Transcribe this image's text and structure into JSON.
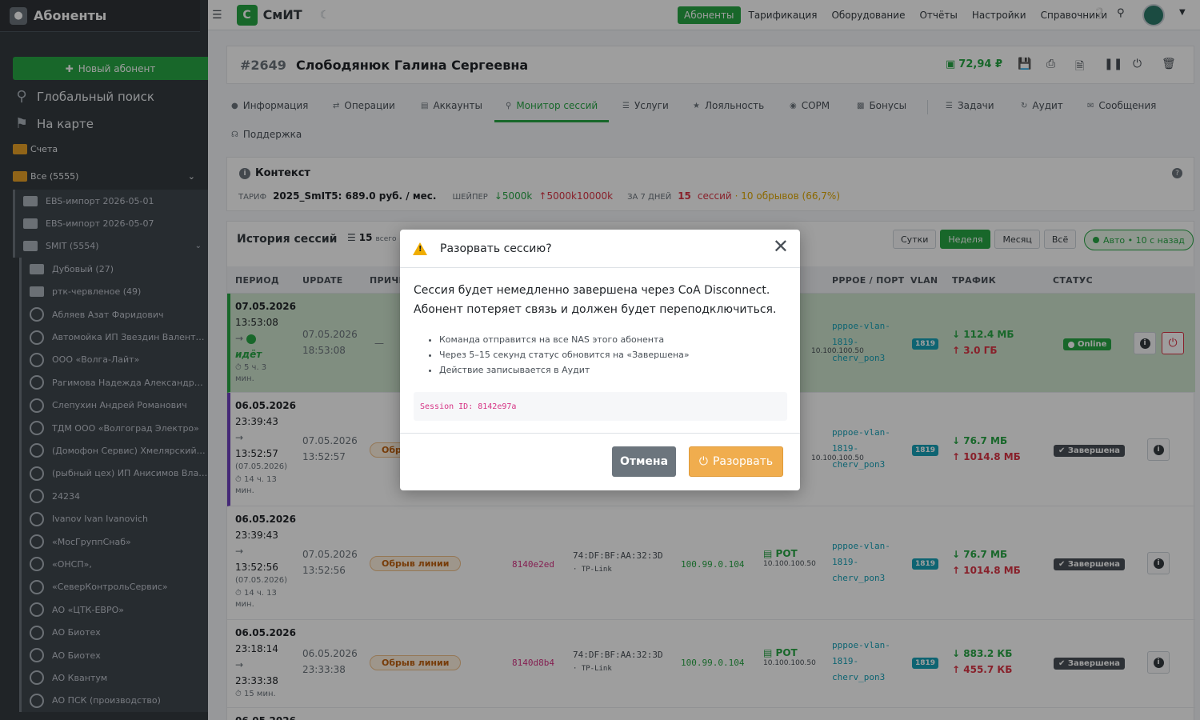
{
  "sidebar": {
    "brand": "Абоненты",
    "new_button": "Новый абонент",
    "global_search": "Глобальный поиск",
    "on_map": "На карте",
    "accounts": "Счета",
    "all": "Все (5555)",
    "folders": [
      "EBS-импорт 2026-05-01",
      "EBS-импорт 2026-05-07",
      "SMIT (5554)"
    ],
    "subfolders": [
      "Дубовый (27)",
      "ртк-червленое (49)"
    ],
    "items": [
      "Абляев Азат Фаридович",
      "Автомойка ИП Звездин Валентин ...",
      "ООО «Волга-Лайт»",
      "Рагимова Надежда Александровна",
      "Слепухин Андрей Романович",
      "ТДМ ООО «Волгоград Электро»",
      "(Домофон Сервис) Хмелярский Се...",
      "(рыбный цех) ИП Анисимов Влади...",
      "24234",
      "Ivanov Ivan Ivanovich",
      "«МосГруппСнаб»",
      "«ОНСП»,",
      "«СеверКонтрольСервис»",
      "АО «ЦТК-ЕВРО»",
      "АО Биотех",
      "АО Биотех",
      "АО Квантум",
      "АО ПСК (производство)"
    ]
  },
  "topnav": {
    "logo_letter": "С",
    "logo_text": "СмИТ",
    "menu": [
      "Абоненты",
      "Тарификация",
      "Оборудование",
      "Отчёты",
      "Настройки",
      "Справочники"
    ]
  },
  "subscriber": {
    "id": "#2649",
    "name": "Слободянюк Галина Сергеевна",
    "balance": "72,94 ₽"
  },
  "tabs": [
    "Информация",
    "Операции",
    "Аккаунты",
    "Монитор сессий",
    "Услуги",
    "Лояльность",
    "СОРМ",
    "Бонусы",
    "Задачи",
    "Аудит",
    "Сообщения",
    "Поддержка"
  ],
  "context": {
    "title": "Контекст",
    "tariff_label": "ТАРИФ",
    "tariff": "2025_SmIT5: 689.0 руб. / мес.",
    "shaper_label": "ШЕЙПЕР",
    "shaper_down": "5000k",
    "shaper_up": "5000k10000k",
    "days_label": "ЗА 7 ДНЕЙ",
    "sessions_count": "15",
    "sessions_word": "сессий",
    "breaks": "· 10 обрывов (66,7%)"
  },
  "history": {
    "title": "История сессий",
    "count": "15",
    "count_word": "всего",
    "periods": [
      "Сутки",
      "Неделя",
      "Месяц",
      "Всё"
    ],
    "auto": "Авто • 10 с назад",
    "columns": [
      "ПЕРИОД",
      "UPDATE",
      "ПРИЧИ",
      "PPPOE / ПОРТ",
      "VLAN",
      "ТРАФИК",
      "СТАТУС"
    ],
    "rows": [
      {
        "start_date": "07.05.2026",
        "start_time": "13:53:08",
        "arrow": "→",
        "state": "идёт",
        "duration": "5 ч. 3",
        "duration2": "мин.",
        "upd_date": "07.05.2026",
        "upd_time": "18:53:08",
        "cause": "—",
        "nas_ip": "10.100.100.50",
        "port1": "pppoe-vlan-",
        "port2": "1819-",
        "port3": "cherv_pon3",
        "vlan": "1819",
        "down": "112.4 МБ",
        "up": "3.0 ГБ",
        "status": "Online"
      },
      {
        "start_date": "06.05.2026",
        "start_time": "23:39:43",
        "arrow": "→",
        "end_time": "13:52:57",
        "end_date": "(07.05.2026)",
        "duration": "14 ч. 13",
        "duration2": "мин.",
        "upd_date": "07.05.2026",
        "upd_time": "13:52:57",
        "cause": "Обр",
        "nas_ip": "10.100.100.50",
        "port1": "pppoe-vlan-",
        "port2": "1819-",
        "port3": "cherv_pon3",
        "vlan": "1819",
        "down": "76.7 МБ",
        "up": "1014.8 МБ",
        "status": "Завершена"
      },
      {
        "start_date": "06.05.2026",
        "start_time": "23:39:43",
        "arrow": "→",
        "end_time": "13:52:56",
        "end_date": "(07.05.2026)",
        "duration": "14 ч. 13",
        "duration2": "мин.",
        "upd_date": "07.05.2026",
        "upd_time": "13:52:56",
        "cause": "Обрыв линии",
        "sid": "8140e2ed",
        "mac": "74:DF:BF:AA:32:3D",
        "vendor": "· TP-Link",
        "ip": "100.99.0.104",
        "nas": "РОТ",
        "nas_ip": "10.100.100.50",
        "port1": "pppoe-vlan-",
        "port2": "1819-",
        "port3": "cherv_pon3",
        "vlan": "1819",
        "down": "76.7 МБ",
        "up": "1014.8 МБ",
        "status": "Завершена"
      },
      {
        "start_date": "06.05.2026",
        "start_time": "23:18:14",
        "arrow": "→",
        "end_time": "23:33:38",
        "duration": "15 мин.",
        "upd_date": "06.05.2026",
        "upd_time": "23:33:38",
        "cause": "Обрыв линии",
        "sid": "8140d8b4",
        "mac": "74:DF:BF:AA:32:3D",
        "vendor": "· TP-Link",
        "ip": "100.99.0.104",
        "nas": "РОТ",
        "nas_ip": "10.100.100.50",
        "port1": "pppoe-vlan-",
        "port2": "1819-",
        "port3": "cherv_pon3",
        "vlan": "1819",
        "down": "883.2 КБ",
        "up": "455.7 КБ",
        "status": "Завершена"
      },
      {
        "start_date": "06.05.2026"
      }
    ]
  },
  "modal": {
    "title": "Разорвать сессию?",
    "text1": "Сессия будет немедленно завершена через CoA Disconnect.",
    "text2": "Абонент потеряет связь и должен будет переподключиться.",
    "bullets": [
      "Команда отправится на все NAS этого абонента",
      "Через 5–15 секунд статус обновится на «Завершена»",
      "Действие записывается в Аудит"
    ],
    "session_id": "Session ID: 8142e97a",
    "cancel": "Отмена",
    "confirm": "Разорвать"
  },
  "colors": {
    "accent": "#28a745",
    "sidebar": "#343a40",
    "danger": "#dc3545",
    "warning": "#f0ad4e"
  }
}
